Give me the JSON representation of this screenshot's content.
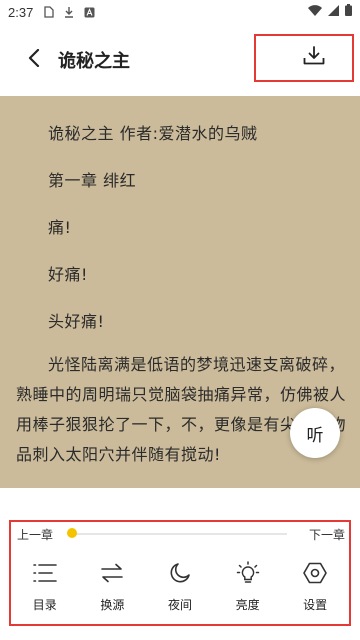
{
  "status_bar": {
    "time": "2:37",
    "icons": [
      "sim-card-icon",
      "download-icon",
      "app-a-icon",
      "wifi-icon",
      "signal-icon",
      "battery-icon"
    ]
  },
  "header": {
    "title": "诡秘之主",
    "back_icon": "chevron-left-icon",
    "download_icon": "download-icon"
  },
  "content": {
    "book_info": "诡秘之主 作者:爱潜水的乌贼",
    "chapter_title": "第一章 绯红",
    "lines": [
      "痛!",
      "好痛!",
      "头好痛!"
    ],
    "paragraph": "光怪陆离满是低语的梦境迅速支离破碎，熟睡中的周明瑞只觉脑袋抽痛异常，仿佛被人用棒子狠狠抡了一下，不，更像是有尖锐的物品刺入太阳穴并伴随有搅动!"
  },
  "listen_button": {
    "label": "听"
  },
  "bottom_bar": {
    "prev_chapter": "上一章",
    "next_chapter": "下一章",
    "progress": 0.0,
    "menu": [
      {
        "label": "目录",
        "icon": "list-icon"
      },
      {
        "label": "换源",
        "icon": "swap-icon"
      },
      {
        "label": "夜间",
        "icon": "moon-icon"
      },
      {
        "label": "亮度",
        "icon": "lightbulb-icon"
      },
      {
        "label": "设置",
        "icon": "settings-icon"
      }
    ]
  },
  "colors": {
    "reading_background": "#cbbb9a",
    "highlight_border": "#e53935",
    "progress_thumb": "#f5c400"
  }
}
